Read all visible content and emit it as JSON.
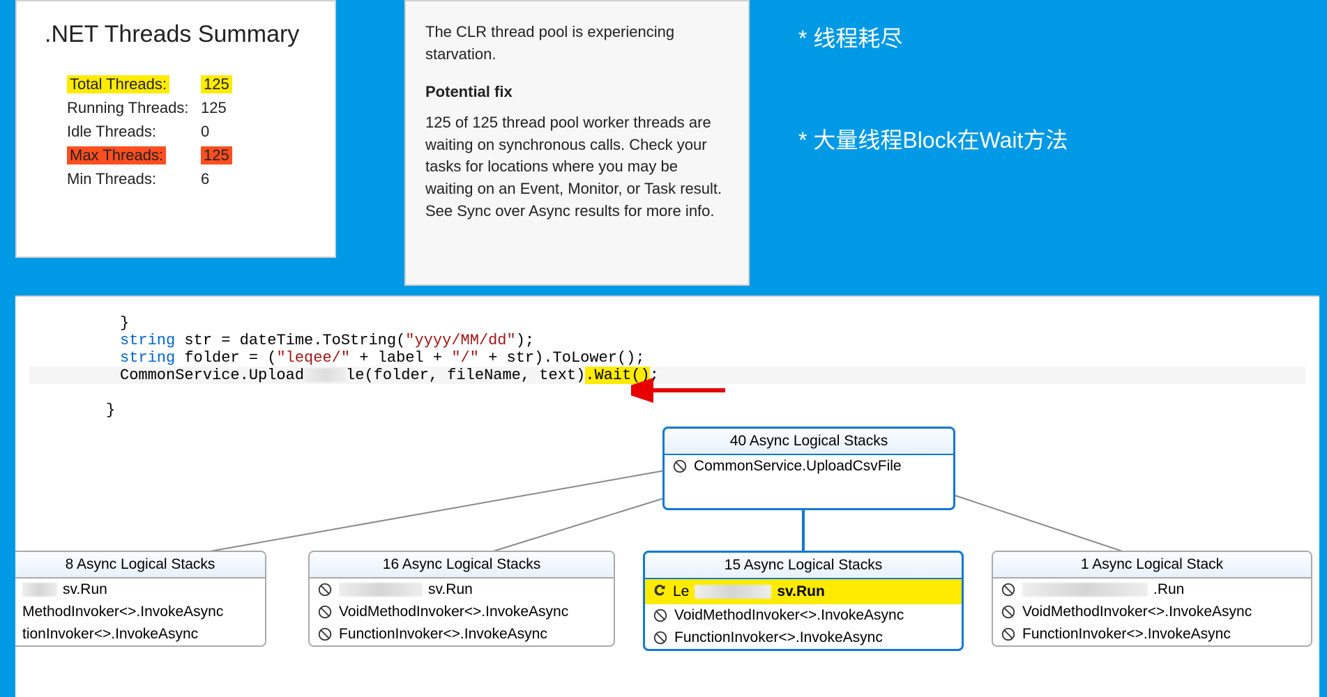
{
  "threads": {
    "title": ".NET Threads Summary",
    "rows": [
      {
        "label": "Total Threads:",
        "value": "125",
        "hl": "yellow"
      },
      {
        "label": "Running Threads:",
        "value": "125",
        "hl": ""
      },
      {
        "label": "Idle Threads:",
        "value": "0",
        "hl": ""
      },
      {
        "label": "Max Threads:",
        "value": "125",
        "hl": "red"
      },
      {
        "label": "Min Threads:",
        "value": "6",
        "hl": ""
      }
    ]
  },
  "fix": {
    "intro": "The CLR thread pool is experiencing starvation.",
    "title": "Potential fix",
    "body": "125 of 125 thread pool worker threads are waiting on synchronous calls. Check your tasks for locations where you may be waiting on an Event, Monitor, or Task result. See Sync over Async results for more info."
  },
  "annotations": {
    "a1": "* 线程耗尽",
    "a2": "* 大量线程Block在Wait方法"
  },
  "code": {
    "line1_brace": "}",
    "line2_kw": "string",
    "line2_rest_a": " str = dateTime.ToString(",
    "line2_str": "\"yyyy/MM/dd\"",
    "line2_rest_b": ");",
    "line3_kw": "string",
    "line3_rest_a": " folder = (",
    "line3_str1": "\"leqee/\"",
    "line3_rest_b": " + label + ",
    "line3_str2": "\"/\"",
    "line3_rest_c": " + str).ToLower();",
    "line4_a": "CommonService.Upload",
    "line4_b": "le(folder, fileName, text)",
    "line4_hl": ".Wait()",
    "line4_c": ";",
    "line5_brace": "}"
  },
  "stacks": {
    "top": {
      "header": "40 Async Logical Stacks",
      "row1": "CommonService.UploadCsvFile"
    },
    "s8": {
      "header": "8 Async Logical Stacks",
      "r1_suffix": "sv.Run",
      "r2": "MethodInvoker<>.InvokeAsync",
      "r3": "tionInvoker<>.InvokeAsync"
    },
    "s16": {
      "header": "16 Async Logical Stacks",
      "r1_suffix": "sv.Run",
      "r2": "VoidMethodInvoker<>.InvokeAsync",
      "r3": "FunctionInvoker<>.InvokeAsync"
    },
    "s15": {
      "header": "15 Async Logical Stacks",
      "r1_prefix": "Le",
      "r1_suffix": "sv.Run",
      "r2": "VoidMethodInvoker<>.InvokeAsync",
      "r3": "FunctionInvoker<>.InvokeAsync"
    },
    "s1": {
      "header": "1 Async Logical Stack",
      "r1_suffix": ".Run",
      "r2": "VoidMethodInvoker<>.InvokeAsync",
      "r3": "FunctionInvoker<>.InvokeAsync"
    }
  }
}
